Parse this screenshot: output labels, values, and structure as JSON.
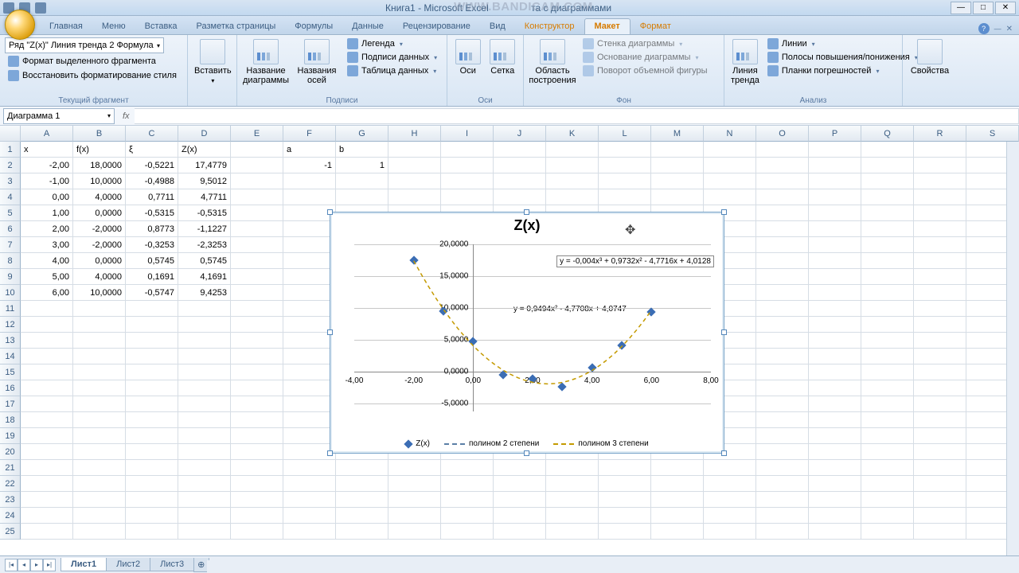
{
  "title_bar": {
    "doc": "Книга1 - Microsoft Excel",
    "context": "та с диаграммами",
    "watermark": "WWW.BANDICAM.COM"
  },
  "tabs": {
    "t0": "Главная",
    "t1": "Меню",
    "t2": "Вставка",
    "t3": "Разметка страницы",
    "t4": "Формулы",
    "t5": "Данные",
    "t6": "Рецензирование",
    "t7": "Вид",
    "t8": "Конструктор",
    "t9": "Макет",
    "t10": "Формат"
  },
  "ribbon": {
    "sel_combo": "Ряд \"Z(x)\" Линия тренда 2 Формула",
    "g1_b1": "Формат выделенного фрагмента",
    "g1_b2": "Восстановить форматирование стиля",
    "g1_label": "Текущий фрагмент",
    "g2_insert": "Вставить",
    "g3_name": "Название\nдиаграммы",
    "g3_axes": "Названия\nосей",
    "g3_legend": "Легенда",
    "g3_datalabels": "Подписи данных",
    "g3_datatable": "Таблица данных",
    "g3_label": "Подписи",
    "g4_axes": "Оси",
    "g4_grid": "Сетка",
    "g4_label": "Оси",
    "g5_plotarea": "Область\nпостроения",
    "g5_wall": "Стенка диаграммы",
    "g5_floor": "Основание диаграммы",
    "g5_rotation": "Поворот объемной фигуры",
    "g5_label": "Фон",
    "g6_trend": "Линия\nтренда",
    "g6_lines": "Линии",
    "g6_updown": "Полосы повышения/понижения",
    "g6_errbars": "Планки погрешностей",
    "g6_label": "Анализ",
    "g7_props": "Свойства"
  },
  "name_box": "Диаграмма 1",
  "columns": [
    "A",
    "B",
    "C",
    "D",
    "E",
    "F",
    "G",
    "H",
    "I",
    "J",
    "K",
    "L",
    "M",
    "N",
    "O",
    "P",
    "Q",
    "R",
    "S"
  ],
  "headers": {
    "A": "x",
    "B": "f(x)",
    "C": "ξ",
    "D": "Z(x)",
    "F": "a",
    "G": "b"
  },
  "header_row2": {
    "F": "-1",
    "G": "1"
  },
  "data_rows": [
    {
      "A": "-2,00",
      "B": "18,0000",
      "C": "-0,5221",
      "D": "17,4779"
    },
    {
      "A": "-1,00",
      "B": "10,0000",
      "C": "-0,4988",
      "D": "9,5012"
    },
    {
      "A": "0,00",
      "B": "4,0000",
      "C": "0,7711",
      "D": "4,7711"
    },
    {
      "A": "1,00",
      "B": "0,0000",
      "C": "-0,5315",
      "D": "-0,5315"
    },
    {
      "A": "2,00",
      "B": "-2,0000",
      "C": "0,8773",
      "D": "-1,1227"
    },
    {
      "A": "3,00",
      "B": "-2,0000",
      "C": "-0,3253",
      "D": "-2,3253"
    },
    {
      "A": "4,00",
      "B": "0,0000",
      "C": "0,5745",
      "D": "0,5745"
    },
    {
      "A": "5,00",
      "B": "4,0000",
      "C": "0,1691",
      "D": "4,1691"
    },
    {
      "A": "6,00",
      "B": "10,0000",
      "C": "-0,5747",
      "D": "9,4253"
    }
  ],
  "chart_data": {
    "type": "scatter",
    "title": "Z(x)",
    "xlabel": "",
    "ylabel": "",
    "xlim": [
      -4,
      8
    ],
    "ylim": [
      -5,
      20
    ],
    "xticks": [
      "-4,00",
      "-2,00",
      "0,00",
      "2,00",
      "4,00",
      "6,00",
      "8,00"
    ],
    "yticks": [
      "-5,0000",
      "0,0000",
      "5,0000",
      "10,0000",
      "15,0000",
      "20,0000"
    ],
    "series": [
      {
        "name": "Z(x)",
        "x": [
          -2,
          -1,
          0,
          1,
          2,
          3,
          4,
          5,
          6
        ],
        "y": [
          17.4779,
          9.5012,
          4.7711,
          -0.5315,
          -1.1227,
          -2.3253,
          0.5745,
          4.1691,
          9.4253
        ]
      }
    ],
    "trendlines": [
      {
        "name": "полином 2 степени",
        "equation": "y = 0,9494x² - 4,7708x + 4,0747",
        "color": "#c49a00",
        "dash": "dashed"
      },
      {
        "name": "полином 3 степени",
        "equation": "y = -0,004x³ + 0,9732x² - 4,7716x + 4,0128",
        "color": "#5b7fa6",
        "dash": "dashed"
      }
    ],
    "legend": [
      "Z(x)",
      "полином 2 степени",
      "полином 3 степени"
    ]
  },
  "sheets": {
    "s1": "Лист1",
    "s2": "Лист2",
    "s3": "Лист3"
  }
}
